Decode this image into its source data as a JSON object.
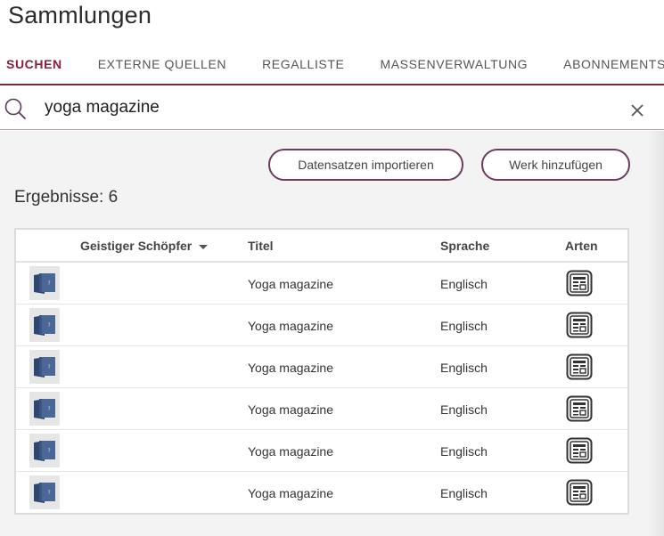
{
  "page": {
    "title": "Sammlungen"
  },
  "tabs": [
    {
      "label": "SUCHEN",
      "active": true
    },
    {
      "label": "EXTERNE QUELLEN",
      "active": false
    },
    {
      "label": "REGALLISTE",
      "active": false
    },
    {
      "label": "MASSENVERWALTUNG",
      "active": false
    },
    {
      "label": "ABONNEMENTS",
      "active": false
    }
  ],
  "search": {
    "value": "yoga magazine",
    "icon": "search-icon",
    "clear_icon": "close-icon"
  },
  "actions": {
    "import_label": "Datensatzen importieren",
    "add_label": "Werk hinzufügen"
  },
  "results": {
    "count_label": "Ergebnisse: 6",
    "columns": {
      "creator": "Geistiger Schöpfer",
      "title": "Titel",
      "language": "Sprache",
      "types": "Arten"
    },
    "rows": [
      {
        "title": "Yoga magazine",
        "language": "Englisch",
        "type_icon": "serial-icon"
      },
      {
        "title": "Yoga magazine",
        "language": "Englisch",
        "type_icon": "serial-icon"
      },
      {
        "title": "Yoga magazine",
        "language": "Englisch",
        "type_icon": "serial-icon"
      },
      {
        "title": "Yoga magazine",
        "language": "Englisch",
        "type_icon": "serial-icon"
      },
      {
        "title": "Yoga magazine",
        "language": "Englisch",
        "type_icon": "serial-icon"
      },
      {
        "title": "Yoga magazine",
        "language": "Englisch",
        "type_icon": "serial-icon"
      }
    ]
  },
  "colors": {
    "accent": "#8a1f3a",
    "button_border": "#6e3a5e",
    "content_bg": "#f3f3f3",
    "cover_blue": "#3f5a86"
  }
}
